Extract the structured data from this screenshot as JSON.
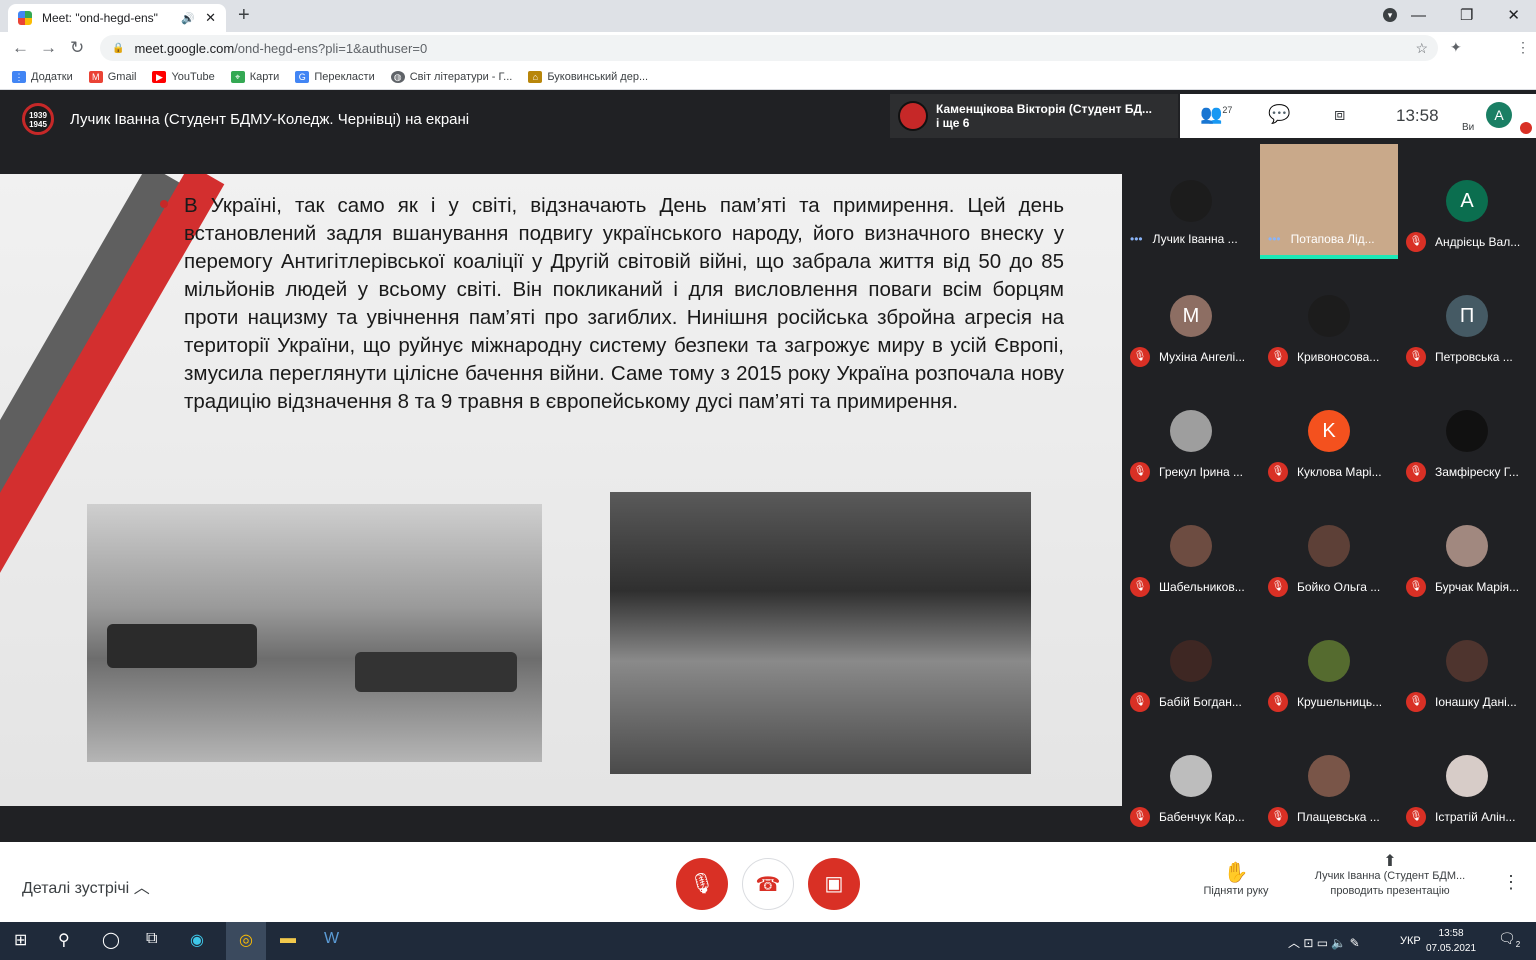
{
  "browser": {
    "tab_title": "Meet: \"ond-hegd-ens\"",
    "url_host": "meet.google.com",
    "url_path": "/ond-hegd-ens?pli=1&authuser=0",
    "profile_initial": "A",
    "bookmarks": [
      "Додатки",
      "Gmail",
      "YouTube",
      "Карти",
      "Перекласти",
      "Світ літератури - Г...",
      "Буковинський дер..."
    ]
  },
  "meet": {
    "presenter_banner": "Лучик Іванна (Студент БДМУ-Коледж. Чернівці) на екрані",
    "logo_text": "1939 1945",
    "speaker_name": "Каменщікова Вікторія (Студент БД...",
    "speaker_more": "і ще 6",
    "participant_count": "27",
    "time": "13:58",
    "you_label": "Ви",
    "you_initial": "A"
  },
  "slide": {
    "text": "В Україні, так само як і у світі, відзначають День пам’яті та примирення. Цей день встановлений задля вшанування подвигу українського народу, його визначного внеску у перемогу Антигітлерівської коаліції у Другій світовій війні, що забрала життя від 50 до 85 мільйонів людей у всьому світі. Він покликаний і для висловлення поваги всім борцям проти нацизму та увічнення пам’яті про загиблих. Нинішня російська збройна агресія на території України, що руйнує міжнародну систему безпеки та загрожує миру в усій Європі, змусила переглянути цілісне бачення війни. Саме тому з 2015 року Україна розпочала нову традицію відзначення 8 та 9 травня в європейському дусі пам’яті та примирення."
  },
  "participants": [
    {
      "name": "Лучик Іванна ...",
      "initial": "",
      "color": "#1c1c1c",
      "muted": false
    },
    {
      "name": "Потапова Лід...",
      "initial": "",
      "color": "#c9a98a",
      "muted": false
    },
    {
      "name": "Андрієць Вал...",
      "initial": "A",
      "color": "#0b6e4f",
      "muted": true
    },
    {
      "name": "Мухіна Ангелі...",
      "initial": "M",
      "color": "#8d6e63",
      "muted": true
    },
    {
      "name": "Кривоносова...",
      "initial": "",
      "color": "#1c1c1c",
      "muted": true
    },
    {
      "name": "Петровська ...",
      "initial": "П",
      "color": "#455a64",
      "muted": true
    },
    {
      "name": "Грекул Ірина ...",
      "initial": "",
      "color": "#9e9e9e",
      "muted": true
    },
    {
      "name": "Куклова Марі...",
      "initial": "K",
      "color": "#f4511e",
      "muted": true
    },
    {
      "name": "Замфіреску Г...",
      "initial": "",
      "color": "#111111",
      "muted": true
    },
    {
      "name": "Шабельников...",
      "initial": "",
      "color": "#6d4c41",
      "muted": true
    },
    {
      "name": "Бойко Ольга ...",
      "initial": "",
      "color": "#5d4037",
      "muted": true
    },
    {
      "name": "Бурчак Марія...",
      "initial": "",
      "color": "#a1887f",
      "muted": true
    },
    {
      "name": "Бабій Богдан...",
      "initial": "",
      "color": "#3e2723",
      "muted": true
    },
    {
      "name": "Крушельниць...",
      "initial": "",
      "color": "#556b2f",
      "muted": true
    },
    {
      "name": "Іонашку Дані...",
      "initial": "",
      "color": "#4e342e",
      "muted": true
    },
    {
      "name": "Бабенчук Кар...",
      "initial": "",
      "color": "#bdbdbd",
      "muted": true
    },
    {
      "name": "Плащевська ...",
      "initial": "",
      "color": "#795548",
      "muted": true
    },
    {
      "name": "Істратій Алін...",
      "initial": "",
      "color": "#d7ccc8",
      "muted": true
    }
  ],
  "controls": {
    "details_label": "Деталі зустрічі",
    "raise_hand_label": "Підняти руку",
    "presenting_line1": "Лучик Іванна (Студент БДМ...",
    "presenting_line2": "проводить презентацію",
    "mic_color": "#d93025"
  },
  "taskbar": {
    "lang": "УКР",
    "time": "13:58",
    "date": "07.05.2021",
    "notif": "2"
  }
}
